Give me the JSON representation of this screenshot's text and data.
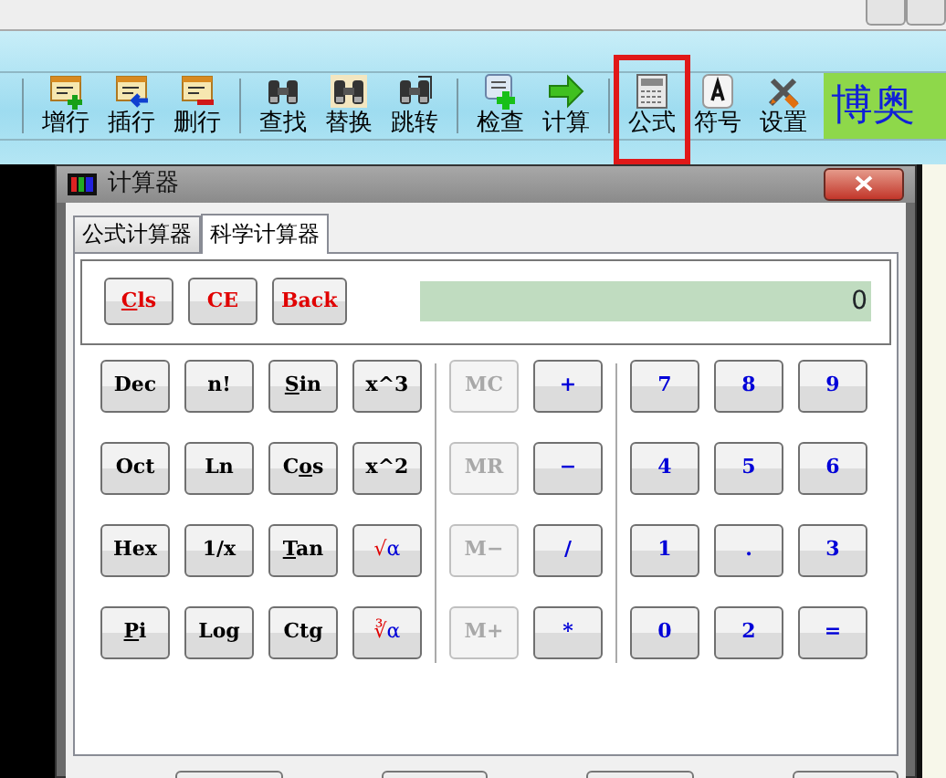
{
  "toolbar": {
    "groups": [
      [
        {
          "label": "增行",
          "kind": "add-row",
          "highlighted": false
        },
        {
          "label": "插行",
          "kind": "insert-row",
          "highlighted": false
        },
        {
          "label": "删行",
          "kind": "delete-row",
          "highlighted": false
        }
      ],
      [
        {
          "label": "查找",
          "kind": "find",
          "highlighted": false
        },
        {
          "label": "替换",
          "kind": "replace",
          "highlighted": false
        },
        {
          "label": "跳转",
          "kind": "goto",
          "highlighted": false
        }
      ],
      [
        {
          "label": "检查",
          "kind": "check",
          "highlighted": false
        },
        {
          "label": "计算",
          "kind": "compute",
          "highlighted": false
        }
      ],
      [
        {
          "label": "公式",
          "kind": "formula",
          "highlighted": true
        },
        {
          "label": "符号",
          "kind": "symbol",
          "highlighted": false
        },
        {
          "label": "设置",
          "kind": "settings",
          "highlighted": false
        }
      ]
    ],
    "logo": "博奥"
  },
  "dialog": {
    "title": "计算器",
    "tabs": [
      {
        "label": "公式计算器",
        "selected": false
      },
      {
        "label": "科学计算器",
        "selected": true
      }
    ],
    "top_buttons": [
      {
        "parts": [
          {
            "text": "C",
            "underlined": true
          },
          {
            "text": "ls",
            "underlined": false
          }
        ]
      },
      {
        "parts": [
          {
            "text": "CE",
            "underlined": false
          }
        ]
      },
      {
        "parts": [
          {
            "text": "Back",
            "underlined": false
          }
        ]
      }
    ],
    "display": "0",
    "sections": [
      {
        "rows": [
          [
            {
              "label": "Dec",
              "kind": "function",
              "disabled": false
            },
            {
              "label": "n!",
              "kind": "function",
              "disabled": false
            },
            {
              "parts": [
                {
                  "text": "S",
                  "underlined": true
                },
                {
                  "text": "in",
                  "underlined": false
                }
              ],
              "kind": "function",
              "disabled": false
            },
            {
              "label": "x^3",
              "kind": "function",
              "disabled": false
            }
          ],
          [
            {
              "label": "Oct",
              "kind": "function",
              "disabled": false
            },
            {
              "label": "Ln",
              "kind": "function",
              "disabled": false
            },
            {
              "parts": [
                {
                  "text": "C",
                  "underlined": false
                },
                {
                  "text": "o",
                  "underlined": true
                },
                {
                  "text": "s",
                  "underlined": false
                }
              ],
              "kind": "function",
              "disabled": false
            },
            {
              "label": "x^2",
              "kind": "function",
              "disabled": false
            }
          ],
          [
            {
              "label": "Hex",
              "kind": "function",
              "disabled": false
            },
            {
              "label": "1/x",
              "kind": "function",
              "disabled": false
            },
            {
              "parts": [
                {
                  "text": "T",
                  "underlined": true
                },
                {
                  "text": "an",
                  "underlined": false
                }
              ],
              "kind": "function",
              "disabled": false
            },
            {
              "label": "√α",
              "kind": "radical",
              "disabled": false
            }
          ],
          [
            {
              "parts": [
                {
                  "text": "P",
                  "underlined": true
                },
                {
                  "text": "i",
                  "underlined": false
                }
              ],
              "kind": "function",
              "disabled": false
            },
            {
              "label": "Log",
              "kind": "function",
              "disabled": false
            },
            {
              "label": "Ctg",
              "kind": "function",
              "disabled": false
            },
            {
              "label": "∛α",
              "kind": "radical",
              "disabled": false
            }
          ]
        ]
      },
      {
        "rows": [
          [
            {
              "label": "MC",
              "kind": "memory",
              "disabled": true
            },
            {
              "label": "+",
              "kind": "operator",
              "disabled": false
            }
          ],
          [
            {
              "label": "MR",
              "kind": "memory",
              "disabled": true
            },
            {
              "label": "−",
              "kind": "operator",
              "disabled": false
            }
          ],
          [
            {
              "label": "M−",
              "kind": "memory",
              "disabled": true
            },
            {
              "label": "/",
              "kind": "operator",
              "disabled": false
            }
          ],
          [
            {
              "label": "M+",
              "kind": "memory",
              "disabled": true
            },
            {
              "label": "*",
              "kind": "operator",
              "disabled": false
            }
          ]
        ]
      },
      {
        "rows": [
          [
            {
              "label": "7",
              "kind": "digit",
              "disabled": false
            },
            {
              "label": "8",
              "kind": "digit",
              "disabled": false
            },
            {
              "label": "9",
              "kind": "digit",
              "disabled": false
            }
          ],
          [
            {
              "label": "4",
              "kind": "digit",
              "disabled": false
            },
            {
              "label": "5",
              "kind": "digit",
              "disabled": false
            },
            {
              "label": "6",
              "kind": "digit",
              "disabled": false
            }
          ],
          [
            {
              "label": "1",
              "kind": "digit",
              "disabled": false
            },
            {
              "label": ".",
              "kind": "digit",
              "disabled": false
            },
            {
              "label": "3",
              "kind": "digit",
              "disabled": false
            }
          ],
          [
            {
              "label": "0",
              "kind": "digit",
              "disabled": false
            },
            {
              "label": "2",
              "kind": "digit",
              "disabled": false
            },
            {
              "label": "=",
              "kind": "operator",
              "disabled": false
            }
          ]
        ]
      }
    ]
  }
}
